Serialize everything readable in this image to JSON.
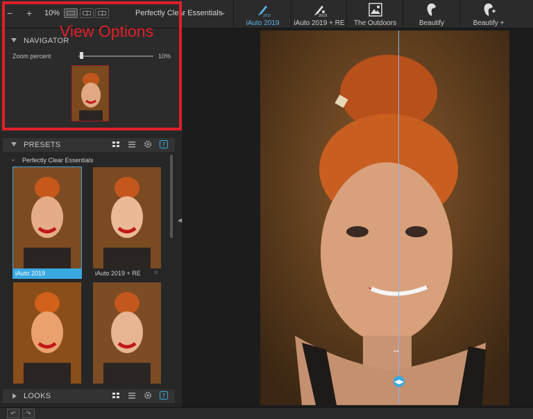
{
  "toolbar": {
    "zoom_out": "−",
    "zoom_in": "+",
    "zoom_value": "10%",
    "preset_dropdown": "Perfectly Clear Essentials",
    "tabs": [
      {
        "label": "iAuto 2019",
        "icon": "brush-2019-icon",
        "active": true
      },
      {
        "label": "iAuto 2019 + RE",
        "icon": "brush-2019-re-icon",
        "active": false
      },
      {
        "label": "The Outdoors",
        "icon": "landscape-icon",
        "active": false
      },
      {
        "label": "Beautify",
        "icon": "face-icon",
        "active": false
      },
      {
        "label": "Beautify +",
        "icon": "face-plus-icon",
        "active": false
      }
    ]
  },
  "navigator": {
    "title": "NAVIGATOR",
    "zoom_label": "Zoom percent",
    "zoom_value": "10%",
    "slider_level": 0.02
  },
  "annotation": {
    "text": "View Options",
    "color": "#e0202a"
  },
  "presets": {
    "title": "PRESETS",
    "group": "Perfectly Clear Essentials",
    "items": [
      {
        "label": "iAuto 2019",
        "selected": true
      },
      {
        "label": "iAuto 2019 + RE",
        "selected": false
      },
      {
        "label": "",
        "selected": false
      },
      {
        "label": "",
        "selected": false
      }
    ]
  },
  "looks": {
    "title": "LOOKS"
  },
  "colors": {
    "accent": "#3aa8e0",
    "annotation": "#e0202a"
  }
}
